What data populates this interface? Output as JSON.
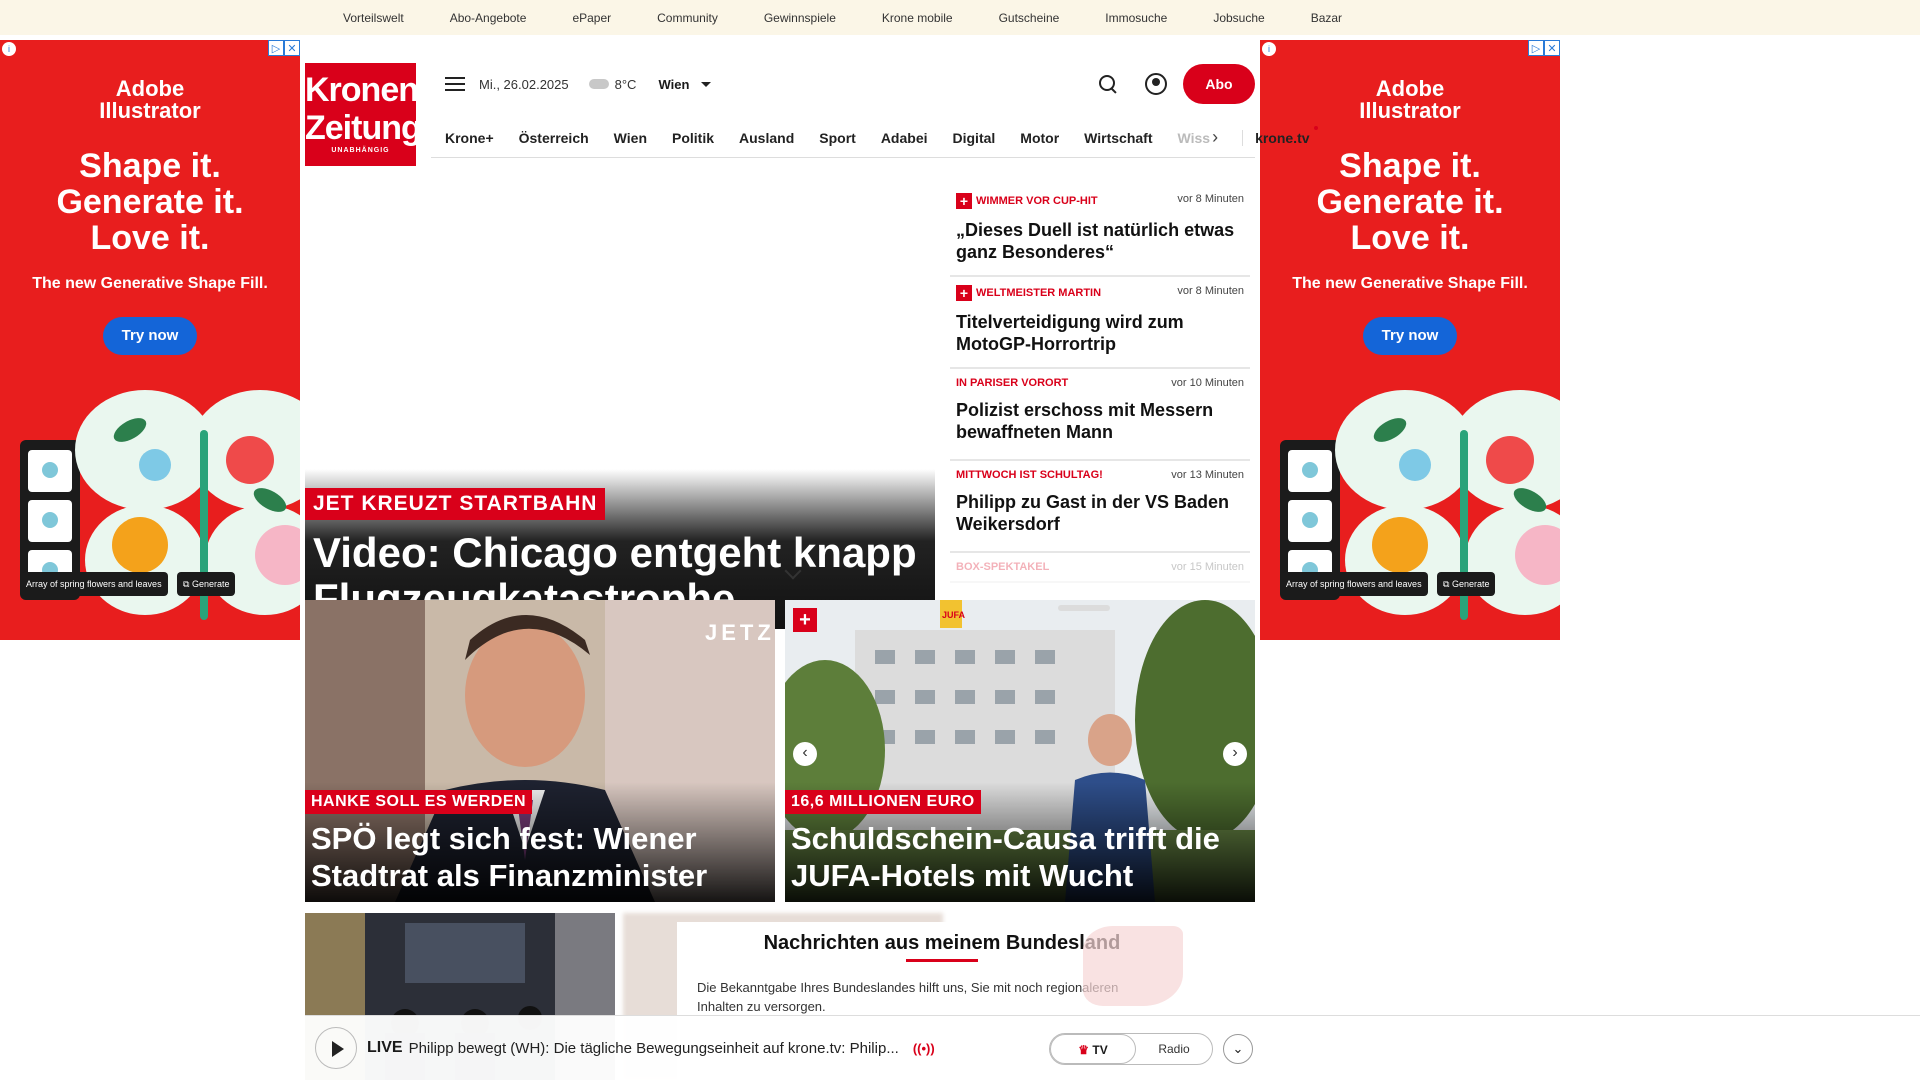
{
  "topnav": [
    "Vorteilswelt",
    "Abo-Angebote",
    "ePaper",
    "Community",
    "Gewinnspiele",
    "Krone mobile",
    "Gutscheine",
    "Immosuche",
    "Jobsuche",
    "Bazar"
  ],
  "ad": {
    "brand_line1": "Adobe",
    "brand_line2": "Illustrator",
    "headline1": "Shape it.",
    "headline2": "Generate it.",
    "headline3": "Love it.",
    "subline": "The new Generative Shape Fill.",
    "cta": "Try now",
    "prompt_chip": "Array of spring flowers and leaves",
    "generate_chip": "Generate",
    "colors": {
      "bg": "#e81e1e",
      "button": "#1465d8"
    }
  },
  "logo": {
    "line1": "Kronen",
    "line2": "Zeitung",
    "line3": "UNABHÄNGIG"
  },
  "header": {
    "date": "Mi., 26.02.2025",
    "temperature": "8°C",
    "city": "Wien",
    "abo_label": "Abo"
  },
  "nav": {
    "items": [
      "Krone+",
      "Österreich",
      "Wien",
      "Politik",
      "Ausland",
      "Sport",
      "Adabei",
      "Digital",
      "Motor",
      "Wirtschaft"
    ],
    "faded": "Wiss",
    "tv": "krone.tv"
  },
  "hero": {
    "kicker": "JET KREUZT STARTBAHN",
    "title": "Video: Chicago entgeht knapp Flugzeugkatastrophe"
  },
  "ticker": [
    {
      "kicker": "WIMMER VOR CUP-HIT",
      "time": "vor 8 Minuten",
      "title": "„Dieses Duell ist natürlich etwas ganz Besonderes“",
      "plus": true
    },
    {
      "kicker": "WELTMEISTER MARTIN",
      "time": "vor 8 Minuten",
      "title": "Titelverteidigung wird zum MotoGP-Horrortrip",
      "plus": true
    },
    {
      "kicker": "IN PARISER VORORT",
      "time": "vor 10 Minuten",
      "title": "Polizist erschoss mit Messern bewaffneten Mann",
      "plus": false
    },
    {
      "kicker": "MITTWOCH IST SCHULTAG!",
      "time": "vor 13 Minuten",
      "title": "Philipp zu Gast in der VS Baden Weikersdorf",
      "plus": false
    },
    {
      "kicker": "BOX-SPEKTAKEL",
      "time": "vor 15 Minuten",
      "title": "",
      "plus": false
    }
  ],
  "cards": [
    {
      "kicker": "HANKE SOLL ES WERDEN",
      "title": "SPÖ legt sich fest: Wiener Stadtrat als Finanzminister",
      "overlay_text": "JETZ"
    },
    {
      "kicker": "16,6 MILLIONEN EURO",
      "title": "Schuldschein-Causa trifft die JUFA-Hotels mit Wucht",
      "overlay_text": "JUFA"
    }
  ],
  "bundesland": {
    "heading": "Nachrichten aus meinem Bundesland",
    "text": "Die Bekanntgabe Ihres Bundeslandes hilft uns, Sie mit noch regionaleren Inhalten zu versorgen."
  },
  "player": {
    "live": "LIVE",
    "text": "Philipp bewegt (WH): Die tägliche Bewegungseinheit auf krone.tv: Philip...",
    "radio_icon": "((•))",
    "tv_label": "TV",
    "radio_label": "Radio"
  },
  "colors": {
    "brand_red": "#d9001a",
    "topbar_bg": "#fbf6e7"
  }
}
